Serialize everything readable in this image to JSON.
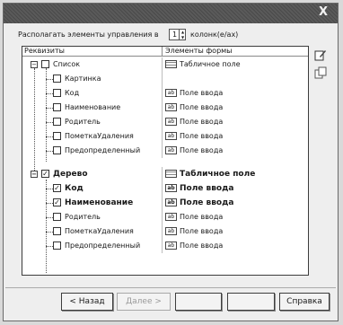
{
  "window": {
    "title": "",
    "close_glyph": "X"
  },
  "columns": {
    "label": "Располагать элементы управления в",
    "value": "1",
    "suffix": "колонк(е/ах)"
  },
  "table": {
    "header_props": "Реквизиты",
    "header_elements": "Элементы формы",
    "rows": [
      {
        "name": "Список",
        "type": "Табличное поле",
        "type_icon": "table-icon"
      },
      {
        "name": "Картинка",
        "type": "",
        "type_icon": ""
      },
      {
        "name": "Код",
        "type": "Поле ввода",
        "type_icon": "input-field-icon"
      },
      {
        "name": "Наименование",
        "type": "Поле ввода",
        "type_icon": "input-field-icon"
      },
      {
        "name": "Родитель",
        "type": "Поле ввода",
        "type_icon": "input-field-icon"
      },
      {
        "name": "ПометкаУдаления",
        "type": "Поле ввода",
        "type_icon": "input-field-icon"
      },
      {
        "name": "Предопределенный",
        "type": "Поле ввода",
        "type_icon": "input-field-icon"
      },
      {
        "name": "Дерево",
        "type": "Табличное поле",
        "type_icon": "table-icon"
      },
      {
        "name": "Код",
        "type": "Поле ввода",
        "type_icon": "input-field-icon"
      },
      {
        "name": "Наименование",
        "type": "Поле ввода",
        "type_icon": "input-field-icon"
      },
      {
        "name": "Родитель",
        "type": "Поле ввода",
        "type_icon": "input-field-icon"
      },
      {
        "name": "ПометкаУдаления",
        "type": "Поле ввода",
        "type_icon": "input-field-icon"
      },
      {
        "name": "Предопределенный",
        "type": "Поле ввода",
        "type_icon": "input-field-icon"
      }
    ]
  },
  "icons": {
    "input_glyph": "ab"
  },
  "buttons": {
    "back": "< Назад",
    "next": "Далее >",
    "done": "",
    "cancel": "",
    "help": "Справка"
  }
}
